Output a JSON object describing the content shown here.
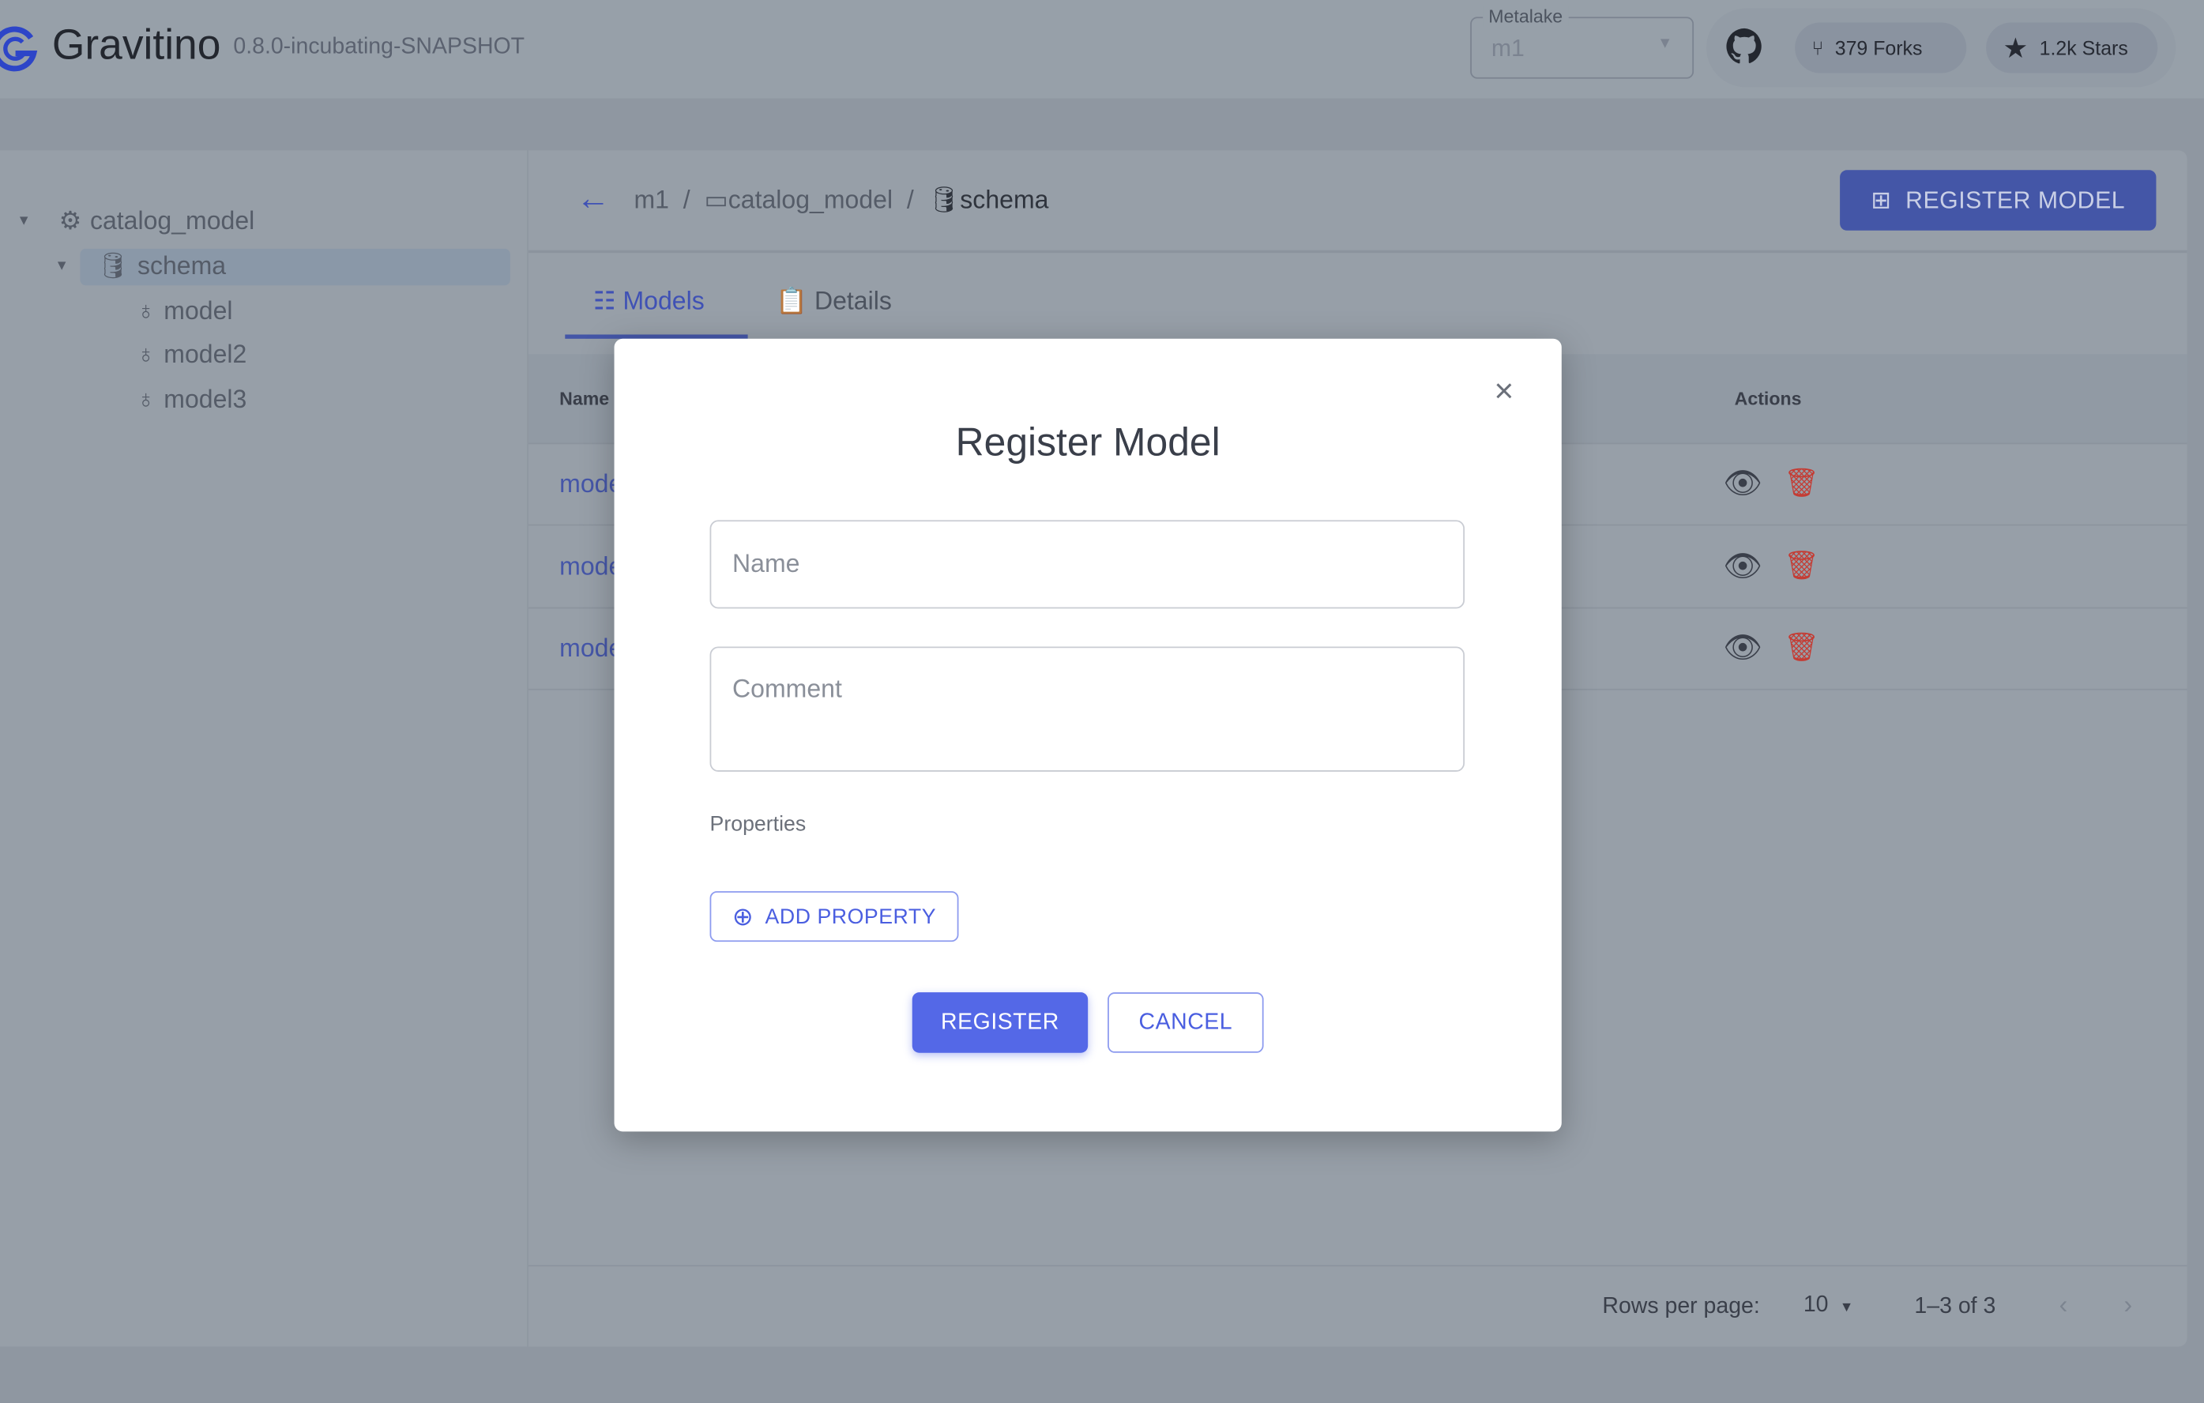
{
  "header": {
    "app_name": "Gravitino",
    "version": "0.8.0-incubating-SNAPSHOT",
    "metalake_label": "Metalake",
    "metalake_value": "m1",
    "forks": "379 Forks",
    "stars": "1.2k Stars"
  },
  "sidebar": {
    "catalog": "catalog_model",
    "schema": "schema",
    "models": [
      "model",
      "model2",
      "model3"
    ]
  },
  "breadcrumb": {
    "metalake": "m1",
    "catalog": "catalog_model",
    "schema": "schema",
    "sep": "/"
  },
  "toolbar": {
    "register_model": "REGISTER MODEL"
  },
  "tabs": [
    {
      "label": "Models"
    },
    {
      "label": "Details"
    }
  ],
  "table": {
    "columns": [
      "Name",
      "Actions"
    ],
    "rows": [
      {
        "name": "model"
      },
      {
        "name": "model2"
      },
      {
        "name": "model3"
      }
    ]
  },
  "pagination": {
    "rows_per_page_label": "Rows per page:",
    "rows_per_page": "10",
    "range": "1–3 of 3"
  },
  "dialog": {
    "title": "Register Model",
    "name_placeholder": "Name",
    "comment_placeholder": "Comment",
    "properties_label": "Properties",
    "add_property": "ADD PROPERTY",
    "register": "REGISTER",
    "cancel": "CANCEL"
  },
  "colors": {
    "primary": "#5468e7",
    "danger": "#e0534a"
  }
}
